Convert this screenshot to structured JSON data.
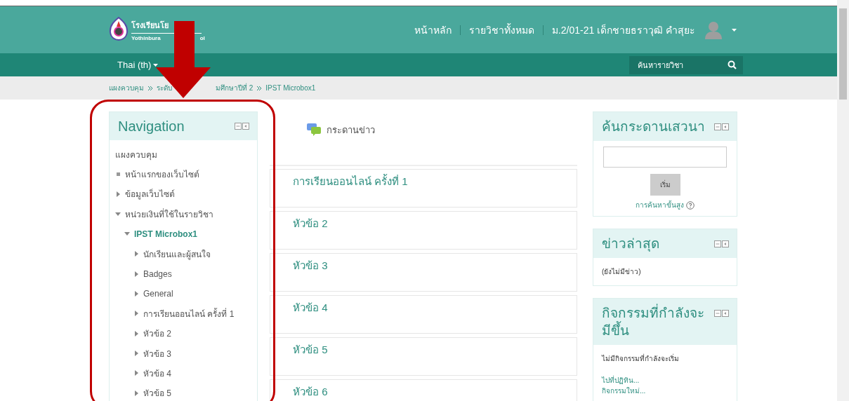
{
  "header": {
    "logo": {
      "title_visible": "โรงเรียนโย",
      "subtitle_visible_start": "Yothinbura",
      "subtitle_visible_end": "ol"
    },
    "links": [
      {
        "label": "หน้าหลัก"
      },
      {
        "label": "รายวิชาทั้งหมด"
      }
    ],
    "user": {
      "name": "ม.2/01-21 เด็กชายธราวุฒิ คำสุยะ"
    }
  },
  "navbar": {
    "language": "Thai (th)",
    "search": {
      "placeholder": "ค้นหารายวิชา"
    }
  },
  "breadcrumb": [
    {
      "label_start": "แผงควบคุม"
    },
    {
      "label_start": "ระดับ",
      "label_end": "มศึกษาปีที่ 2"
    },
    {
      "label_start": "IPST Microbox1"
    }
  ],
  "navigation": {
    "title": "Navigation",
    "items": [
      {
        "label": "แผงควบคุม",
        "kind": "link",
        "current": false
      },
      {
        "label": "หน้าแรกของเว็บไซต์",
        "kind": "leaf",
        "current": false
      },
      {
        "label": "ข้อมูลเว็บไซต์",
        "kind": "branch",
        "expanded": false,
        "current": false
      },
      {
        "label": "หน่วยเงินที่ใช้ในรายวิชา",
        "kind": "branch",
        "expanded": true,
        "current": false,
        "children": [
          {
            "label": "IPST Microbox1",
            "kind": "branch",
            "expanded": true,
            "current": true,
            "children": [
              {
                "label": "นักเรียนและผู้สนใจ",
                "kind": "branch",
                "expanded": false,
                "current": false
              },
              {
                "label": "Badges",
                "kind": "branch",
                "expanded": false,
                "current": false
              },
              {
                "label": "General",
                "kind": "branch",
                "expanded": false,
                "current": false
              },
              {
                "label": "การเรียนออนไลน์ ครั้งที่ 1",
                "kind": "branch",
                "expanded": false,
                "current": false
              },
              {
                "label": "หัวข้อ 2",
                "kind": "branch",
                "expanded": false,
                "current": false
              },
              {
                "label": "หัวข้อ 3",
                "kind": "branch",
                "expanded": false,
                "current": false
              },
              {
                "label": "หัวข้อ 4",
                "kind": "branch",
                "expanded": false,
                "current": false
              },
              {
                "label": "หัวข้อ 5",
                "kind": "branch",
                "expanded": false,
                "current": false
              }
            ]
          }
        ]
      }
    ]
  },
  "course": {
    "forum": {
      "label": "กระดานข่าว"
    },
    "sections": [
      {
        "title": "การเรียนออนไลน์ ครั้งที่ 1"
      },
      {
        "title": "หัวข้อ 2"
      },
      {
        "title": "หัวข้อ 3"
      },
      {
        "title": "หัวข้อ 4"
      },
      {
        "title": "หัวข้อ 5"
      },
      {
        "title": "หัวข้อ 6"
      }
    ]
  },
  "blocks": [
    {
      "kind": "search",
      "title": "ค้นกระดานเสวนา",
      "button": "เริ่ม",
      "link": "การค้นหาขั้นสูง"
    },
    {
      "kind": "news",
      "title": "ข่าวล่าสุด",
      "text": "(ยังไม่มีข่าว)"
    },
    {
      "kind": "events",
      "title": "กิจกรรมที่กำลังจะมีขึ้น",
      "text": "ไม่มีกิจกรรมที่กำลังจะเริ่ม",
      "links": [
        "ไปที่ปฏิทิน...",
        "กิจกรรมใหม่..."
      ]
    }
  ]
}
